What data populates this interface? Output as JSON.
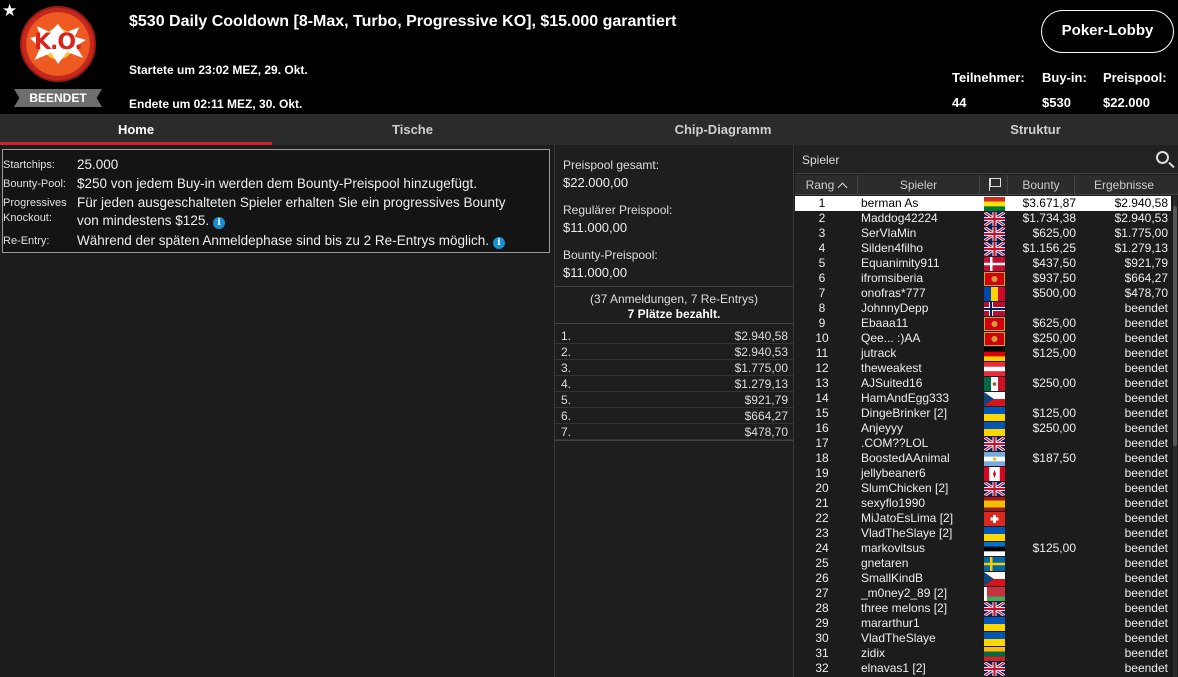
{
  "header": {
    "title": "$530 Daily Cooldown [8-Max, Turbo, Progressive KO], $15.000 garantiert",
    "logo_text": "K.O.",
    "status_badge": "BEENDET",
    "started": "Startete um 23:02 MEZ, 29. Okt.",
    "ended": "Endete um 02:11 MEZ, 30. Okt.",
    "lobby_button": "Poker-Lobby",
    "stats": {
      "players_label": "Teilnehmer:",
      "players_value": "44",
      "buyin_label": "Buy-in:",
      "buyin_value": "$530",
      "prizepool_label": "Preispool:",
      "prizepool_value": "$22.000"
    }
  },
  "tabs": [
    "Home",
    "Tische",
    "Chip-Diagramm",
    "Struktur"
  ],
  "active_tab": "Home",
  "info": {
    "startchips_label": "Startchips:",
    "startchips_value": "25.000",
    "bounty_label": "Bounty-Pool:",
    "bounty_value": "$250 von jedem Buy-in werden dem Bounty-Preispool hinzugefügt.",
    "pko_label_1": "Progressives",
    "pko_label_2": "Knockout:",
    "pko_value_1": "Für jeden ausgeschalteten Spieler erhalten Sie ein progressives Bounty",
    "pko_value_2": "von mindestens $125.",
    "reentry_label": "Re-Entry:",
    "reentry_value": "Während der späten Anmeldephase sind bis zu 2 Re-Entrys möglich."
  },
  "prizepool": {
    "total_label": "Preispool gesamt:",
    "total_value": "$22.000,00",
    "regular_label": "Regulärer Preispool:",
    "regular_value": "$11.000,00",
    "bounty_label": "Bounty-Preispool:",
    "bounty_value": "$11.000,00",
    "registrations": "(37 Anmeldungen, 7 Re-Entrys)",
    "paid_places": "7 Plätze bezahlt."
  },
  "payouts": [
    {
      "place": "1.",
      "amount": "$2.940,58"
    },
    {
      "place": "2.",
      "amount": "$2.940,53"
    },
    {
      "place": "3.",
      "amount": "$1.775,00"
    },
    {
      "place": "4.",
      "amount": "$1.279,13"
    },
    {
      "place": "5.",
      "amount": "$921,79"
    },
    {
      "place": "6.",
      "amount": "$664,27"
    },
    {
      "place": "7.",
      "amount": "$478,70"
    }
  ],
  "players_panel": {
    "search_placeholder": "Spieler",
    "columns": {
      "rank": "Rang",
      "player": "Spieler",
      "bounty": "Bounty",
      "results": "Ergebnisse"
    },
    "rows": [
      {
        "rank": "1",
        "name": "berman As",
        "flag": "BO",
        "bounty": "$3.671,87",
        "result": "$2.940,58"
      },
      {
        "rank": "2",
        "name": "Maddog42224",
        "flag": "GB",
        "bounty": "$1.734,38",
        "result": "$2.940,53"
      },
      {
        "rank": "3",
        "name": "SerVlaMin",
        "flag": "GB",
        "bounty": "$625,00",
        "result": "$1.775,00"
      },
      {
        "rank": "4",
        "name": "Silden4filho",
        "flag": "GB",
        "bounty": "$1.156,25",
        "result": "$1.279,13"
      },
      {
        "rank": "5",
        "name": "Equanimity911",
        "flag": "DK",
        "bounty": "$437,50",
        "result": "$921,79"
      },
      {
        "rank": "6",
        "name": "ifromsiberia",
        "flag": "ME",
        "bounty": "$937,50",
        "result": "$664,27"
      },
      {
        "rank": "7",
        "name": "onofras*777",
        "flag": "MD",
        "bounty": "$500,00",
        "result": "$478,70"
      },
      {
        "rank": "8",
        "name": "JohnnyDepp",
        "flag": "NO",
        "bounty": "",
        "result": "beendet"
      },
      {
        "rank": "9",
        "name": "Ebaaa11",
        "flag": "ME",
        "bounty": "$625,00",
        "result": "beendet"
      },
      {
        "rank": "10",
        "name": "Qee... :)AA",
        "flag": "ME",
        "bounty": "$250,00",
        "result": "beendet"
      },
      {
        "rank": "11",
        "name": "jutrack",
        "flag": "DE",
        "bounty": "$125,00",
        "result": "beendet"
      },
      {
        "rank": "12",
        "name": "theweakest",
        "flag": "AT",
        "bounty": "",
        "result": "beendet"
      },
      {
        "rank": "13",
        "name": "AJSuited16",
        "flag": "MX",
        "bounty": "$250,00",
        "result": "beendet"
      },
      {
        "rank": "14",
        "name": "HamAndEgg333",
        "flag": "CZ",
        "bounty": "",
        "result": "beendet"
      },
      {
        "rank": "15",
        "name": "DingeBrinker [2]",
        "flag": "UA",
        "bounty": "$125,00",
        "result": "beendet"
      },
      {
        "rank": "16",
        "name": "Anjeyyy",
        "flag": "UA",
        "bounty": "$250,00",
        "result": "beendet"
      },
      {
        "rank": "17",
        "name": ".COM??LOL",
        "flag": "GB",
        "bounty": "",
        "result": "beendet"
      },
      {
        "rank": "18",
        "name": "BoostedAAnimal",
        "flag": "AR",
        "bounty": "$187,50",
        "result": "beendet"
      },
      {
        "rank": "19",
        "name": "jellybeaner6",
        "flag": "CA",
        "bounty": "",
        "result": "beendet"
      },
      {
        "rank": "20",
        "name": "SlumChicken [2]",
        "flag": "GB",
        "bounty": "",
        "result": "beendet"
      },
      {
        "rank": "21",
        "name": "sexyflo1990",
        "flag": "ES",
        "bounty": "",
        "result": "beendet"
      },
      {
        "rank": "22",
        "name": "MiJatoEsLima [2]",
        "flag": "CH",
        "bounty": "",
        "result": "beendet"
      },
      {
        "rank": "23",
        "name": "VladTheSlaye [2]",
        "flag": "UA",
        "bounty": "",
        "result": "beendet"
      },
      {
        "rank": "24",
        "name": "markovitsus",
        "flag": "EE",
        "bounty": "$125,00",
        "result": "beendet"
      },
      {
        "rank": "25",
        "name": "gnetaren",
        "flag": "SE",
        "bounty": "",
        "result": "beendet"
      },
      {
        "rank": "26",
        "name": "SmallKindB",
        "flag": "CZ",
        "bounty": "",
        "result": "beendet"
      },
      {
        "rank": "27",
        "name": "_m0ney2_89 [2]",
        "flag": "BY",
        "bounty": "",
        "result": "beendet"
      },
      {
        "rank": "28",
        "name": "three melons [2]",
        "flag": "GB",
        "bounty": "",
        "result": "beendet"
      },
      {
        "rank": "29",
        "name": "mararthur1",
        "flag": "UA",
        "bounty": "",
        "result": "beendet"
      },
      {
        "rank": "30",
        "name": "VladTheSlaye",
        "flag": "UA",
        "bounty": "",
        "result": "beendet"
      },
      {
        "rank": "31",
        "name": "zidix",
        "flag": "LT",
        "bounty": "",
        "result": "beendet"
      },
      {
        "rank": "32",
        "name": "elnavas1 [2]",
        "flag": "GB",
        "bounty": "",
        "result": "beendet"
      }
    ]
  }
}
